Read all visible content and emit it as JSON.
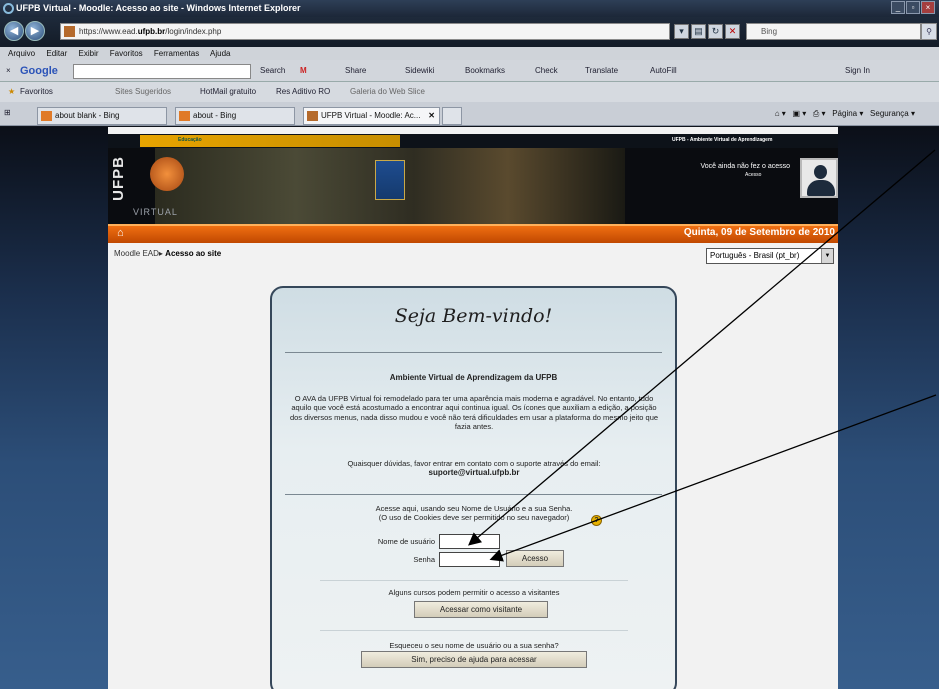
{
  "window": {
    "title": "UFPB Virtual - Moodle: Acesso ao site - Windows Internet Explorer",
    "min": "_",
    "max": "▫",
    "close": "×"
  },
  "address": {
    "url_prefix": "https://www.ead.",
    "url_domain": "ufpb.br",
    "url_path": "/login/index.php",
    "search_placeholder": "Bing"
  },
  "menu": [
    "Arquivo",
    "Editar",
    "Exibir",
    "Favoritos",
    "Ferramentas",
    "Ajuda"
  ],
  "google_toolbar": {
    "logo": "Google",
    "items": [
      "Search",
      "Share",
      "Sidewiki",
      "Bookmarks",
      "Check",
      "Translate",
      "AutoFill",
      "Sign In"
    ]
  },
  "favorites_bar": {
    "label": "Favoritos",
    "items": [
      "Sites Sugeridos",
      "HotMail gratuito",
      "Res Aditivo RO",
      "Galeria do Web Slice"
    ]
  },
  "tabs": [
    {
      "label": "about blank - Bing"
    },
    {
      "label": "about - Bing"
    },
    {
      "label": "UFPB Virtual - Moodle: Ac..."
    }
  ],
  "page_tools": {
    "page": "Página",
    "security": "Segurança"
  },
  "site": {
    "gov_entity": "Educação",
    "top_label": "UFPB - Ambiente Virtual de Aprendizagem",
    "logo_text": "UFPB",
    "logo_sub": "VIRTUAL",
    "not_logged": "Você ainda não fez o acesso",
    "not_logged_link": "Acesso",
    "date": "Quinta, 09 de Setembro de 2010",
    "breadcrumb_root": "Moodle EAD",
    "breadcrumb_current": "Acesso ao site",
    "language": "Português - Brasil (pt_br)"
  },
  "login": {
    "welcome": "Seja Bem-vindo!",
    "env_title": "Ambiente Virtual de Aprendizagem da UFPB",
    "intro": "O AVA da UFPB Virtual foi remodelado para ter uma aparência mais moderna e agradável. No entanto, tudo aquilo que você está acostumado a encontrar aqui continua igual. Os ícones que auxiliam a edição, a posição dos diversos menus, nada disso mudou e você não terá dificuldades em usar a plataforma do mesmo jeito que fazia antes.",
    "contact": "Quaisquer dúvidas, favor entrar em contato com o suporte através do email:",
    "email": "suporte@virtual.ufpb.br",
    "access_line1": "Acesse aqui, usando seu Nome de Usuário e a sua Senha.",
    "access_line2": "(O uso de Cookies deve ser permitido no seu navegador)",
    "username_label": "Nome de usuário",
    "password_label": "Senha",
    "login_button": "Acesso",
    "guest_msg": "Alguns cursos podem permitir o acesso a visitantes",
    "guest_button": "Acessar como visitante",
    "forgot_msg": "Esqueceu o seu nome de usuário ou a sua senha?",
    "forgot_button": "Sim, preciso de ajuda para acessar"
  }
}
